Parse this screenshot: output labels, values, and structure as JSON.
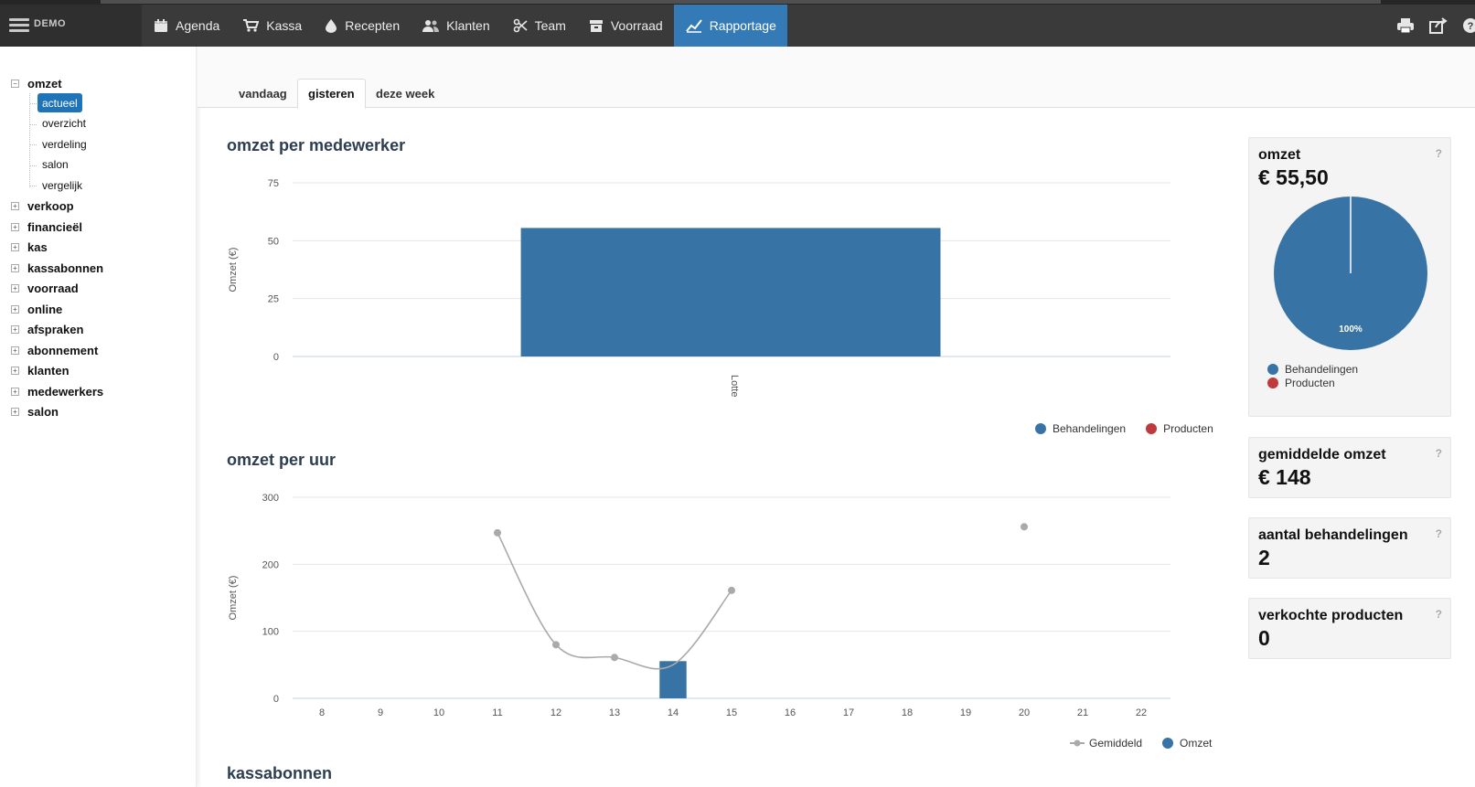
{
  "app": {
    "brand": "DEMO"
  },
  "nav": {
    "items": [
      {
        "label": "Agenda",
        "icon": "calendar-icon"
      },
      {
        "label": "Kassa",
        "icon": "cart-icon"
      },
      {
        "label": "Recepten",
        "icon": "drop-icon"
      },
      {
        "label": "Klanten",
        "icon": "users-icon"
      },
      {
        "label": "Team",
        "icon": "scissors-icon"
      },
      {
        "label": "Voorraad",
        "icon": "archive-icon"
      },
      {
        "label": "Rapportage",
        "icon": "chart-line-icon",
        "active": true
      }
    ],
    "right_icons": [
      "print-icon",
      "share-icon",
      "help-icon"
    ]
  },
  "sidebar": {
    "groups": [
      {
        "label": "omzet",
        "expanded": true,
        "toggle": "−",
        "children": [
          "actueel",
          "overzicht",
          "verdeling",
          "salon",
          "vergelijk"
        ],
        "selected": "actueel"
      },
      {
        "label": "verkoop",
        "toggle": "+"
      },
      {
        "label": "financieël",
        "toggle": "+"
      },
      {
        "label": "kas",
        "toggle": "+"
      },
      {
        "label": "kassabonnen",
        "toggle": "+"
      },
      {
        "label": "voorraad",
        "toggle": "+"
      },
      {
        "label": "online",
        "toggle": "+"
      },
      {
        "label": "afspraken",
        "toggle": "+"
      },
      {
        "label": "abonnement",
        "toggle": "+"
      },
      {
        "label": "klanten",
        "toggle": "+"
      },
      {
        "label": "medewerkers",
        "toggle": "+"
      },
      {
        "label": "salon",
        "toggle": "+"
      }
    ]
  },
  "tabs": [
    {
      "label": "vandaag"
    },
    {
      "label": "gisteren",
      "active": true
    },
    {
      "label": "deze week"
    }
  ],
  "sections": {
    "per_medewerker": "omzet per medewerker",
    "per_uur": "omzet per uur",
    "kassabonnen": "kassabonnen"
  },
  "chart_data": [
    {
      "type": "bar",
      "title": "omzet per medewerker",
      "ylabel": "Omzet (€)",
      "ylim": [
        0,
        75
      ],
      "yticks": [
        0,
        25,
        50,
        75
      ],
      "categories": [
        "Lotte"
      ],
      "series": [
        {
          "name": "Behandelingen",
          "color": "#3873a6",
          "values": [
            55.5
          ]
        },
        {
          "name": "Producten",
          "color": "#c0393b",
          "values": [
            0
          ]
        }
      ],
      "grid": true,
      "legend": "bottom-right"
    },
    {
      "type": "bar",
      "title": "omzet per uur",
      "ylabel": "Omzet (€)",
      "ylim": [
        0,
        300
      ],
      "yticks": [
        0,
        100,
        200,
        300
      ],
      "categories": [
        "8",
        "9",
        "10",
        "11",
        "12",
        "13",
        "14",
        "15",
        "16",
        "17",
        "18",
        "19",
        "20",
        "21",
        "22"
      ],
      "series": [
        {
          "name": "Omzet",
          "type": "bar",
          "color": "#3873a6",
          "values": [
            0,
            0,
            0,
            0,
            0,
            0,
            55.5,
            0,
            0,
            0,
            0,
            0,
            0,
            0,
            0
          ]
        },
        {
          "name": "Gemiddeld",
          "type": "line",
          "color": "#aaaaaa",
          "values": [
            null,
            null,
            null,
            247,
            80,
            61,
            50,
            161,
            null,
            null,
            null,
            null,
            256,
            null,
            null
          ]
        }
      ],
      "grid": true,
      "legend": "bottom-right"
    }
  ],
  "cards": [
    {
      "label": "omzet",
      "value": "€ 55,50",
      "help": "?",
      "pie": {
        "slices": [
          {
            "name": "Behandelingen",
            "color": "#3873a6",
            "percent": 100
          },
          {
            "name": "Producten",
            "color": "#c0393b",
            "percent": 0
          }
        ],
        "label": "100%"
      }
    },
    {
      "label": "gemiddelde omzet",
      "value": "€ 148",
      "help": "?"
    },
    {
      "label": "aantal behandelingen",
      "value": "2",
      "help": "?"
    },
    {
      "label": "verkochte producten",
      "value": "0",
      "help": "?"
    }
  ]
}
